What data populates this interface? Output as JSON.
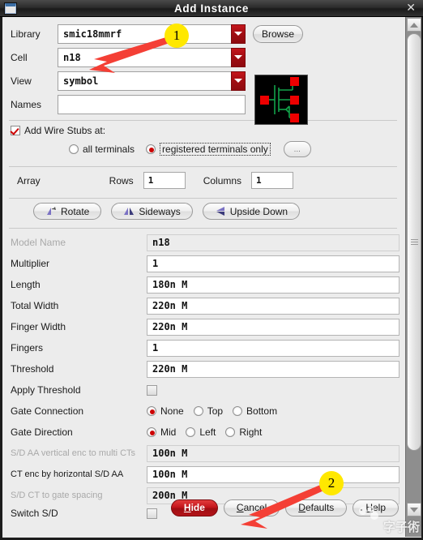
{
  "window": {
    "title": "Add Instance",
    "icon": "window-icon",
    "close_label": "✕"
  },
  "top_fields": [
    {
      "label": "Library",
      "value": "smic18mmrf",
      "type": "combo"
    },
    {
      "label": "Cell",
      "value": "n18",
      "type": "combo"
    },
    {
      "label": "View",
      "value": "symbol",
      "type": "combo"
    },
    {
      "label": "Names",
      "value": "",
      "type": "text"
    }
  ],
  "browse_button": "Browse",
  "wire_stubs": {
    "checkbox_label": "Add Wire Stubs at:",
    "checked": true,
    "options": [
      {
        "label": "all terminals",
        "selected": false
      },
      {
        "label": "registered terminals only",
        "selected": true
      }
    ],
    "more_button": "..."
  },
  "array": {
    "label": "Array",
    "rows_label": "Rows",
    "rows_value": "1",
    "columns_label": "Columns",
    "columns_value": "1"
  },
  "orientation_buttons": [
    {
      "label": "Rotate",
      "icon": "rotate-icon"
    },
    {
      "label": "Sideways",
      "icon": "flip-horizontal-icon"
    },
    {
      "label": "Upside Down",
      "icon": "flip-vertical-icon"
    }
  ],
  "parameters": [
    {
      "label": "Model Name",
      "value": "n18",
      "kind": "field",
      "readonly": true
    },
    {
      "label": "Multiplier",
      "value": "1",
      "kind": "field",
      "readonly": false
    },
    {
      "label": "Length",
      "value": "180n M",
      "kind": "field",
      "readonly": false
    },
    {
      "label": "Total Width",
      "value": "220n M",
      "kind": "field",
      "readonly": false
    },
    {
      "label": "Finger Width",
      "value": "220n M",
      "kind": "field",
      "readonly": false
    },
    {
      "label": "Fingers",
      "value": "1",
      "kind": "field",
      "readonly": false
    },
    {
      "label": "Threshold",
      "value": "220n M",
      "kind": "field",
      "readonly": false
    },
    {
      "label": "Apply Threshold",
      "kind": "checkbox",
      "checked": false,
      "readonly": false
    },
    {
      "label": "Gate Connection",
      "kind": "radios",
      "readonly": false,
      "options": [
        {
          "label": "None",
          "selected": true
        },
        {
          "label": "Top",
          "selected": false
        },
        {
          "label": "Bottom",
          "selected": false
        }
      ]
    },
    {
      "label": "Gate Direction",
      "kind": "radios",
      "readonly": false,
      "options": [
        {
          "label": "Mid",
          "selected": true
        },
        {
          "label": "Left",
          "selected": false
        },
        {
          "label": "Right",
          "selected": false
        }
      ]
    },
    {
      "label": "S/D AA vertical enc to multi CTs",
      "value": "100n M",
      "kind": "field",
      "readonly": true
    },
    {
      "label": "CT enc by horizontal S/D AA",
      "value": "100n M",
      "kind": "field",
      "readonly": false
    },
    {
      "label": "S/D CT to gate spacing",
      "value": "200n M",
      "kind": "field",
      "readonly": true
    },
    {
      "label": "Switch S/D",
      "kind": "checkbox",
      "checked": false,
      "readonly": false
    }
  ],
  "dialog_buttons": [
    {
      "label": "Hide",
      "primary": true
    },
    {
      "label": "Cancel",
      "primary": false
    },
    {
      "label": "Defaults",
      "primary": false
    },
    {
      "label": "Help",
      "primary": false
    }
  ],
  "annotations": [
    {
      "number": "1",
      "target": "cell-field"
    },
    {
      "number": "2",
      "target": "hide-button"
    }
  ],
  "watermark": "字子術",
  "colors": {
    "accent_red": "#c4161c",
    "badge_yellow": "#ffe800",
    "arrow_red": "#f43f35",
    "symbol_green": "#12a34a",
    "terminal_red": "#ee0000",
    "titlebar": "#2c2c2c"
  }
}
